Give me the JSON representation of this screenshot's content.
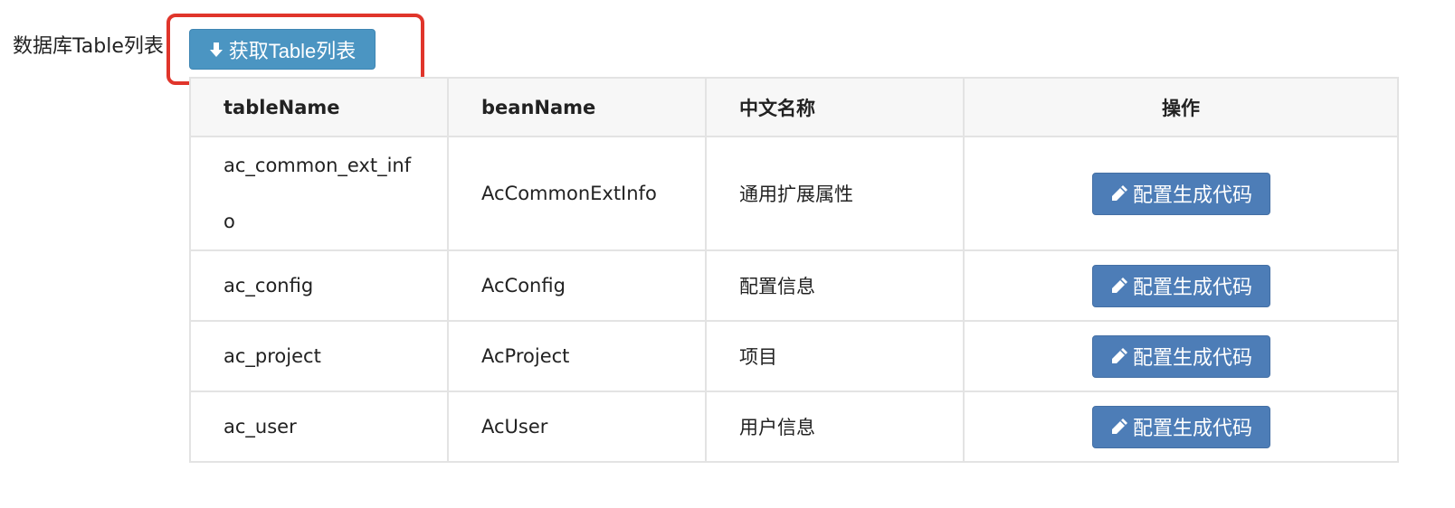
{
  "section": {
    "label": "数据库Table列表",
    "fetch_button_label": "获取Table列表",
    "fetch_icon": "download-arrow-icon"
  },
  "table": {
    "headers": [
      "tableName",
      "beanName",
      "中文名称",
      "操作"
    ],
    "rows": [
      {
        "tableName": "ac_common_ext_info",
        "beanName": "AcCommonExtInfo",
        "cnName": "通用扩展属性",
        "action": "配置生成代码"
      },
      {
        "tableName": "ac_config",
        "beanName": "AcConfig",
        "cnName": "配置信息",
        "action": "配置生成代码"
      },
      {
        "tableName": "ac_project",
        "beanName": "AcProject",
        "cnName": "项目",
        "action": "配置生成代码"
      },
      {
        "tableName": "ac_user",
        "beanName": "AcUser",
        "cnName": "用户信息",
        "action": "配置生成代码"
      }
    ],
    "action_icon": "pencil-icon"
  },
  "colors": {
    "fetch_button": "#4b95c2",
    "action_button": "#4d7db7",
    "highlight": "#e0352b",
    "header_bg": "#f7f7f7",
    "border": "#e3e3e3"
  }
}
